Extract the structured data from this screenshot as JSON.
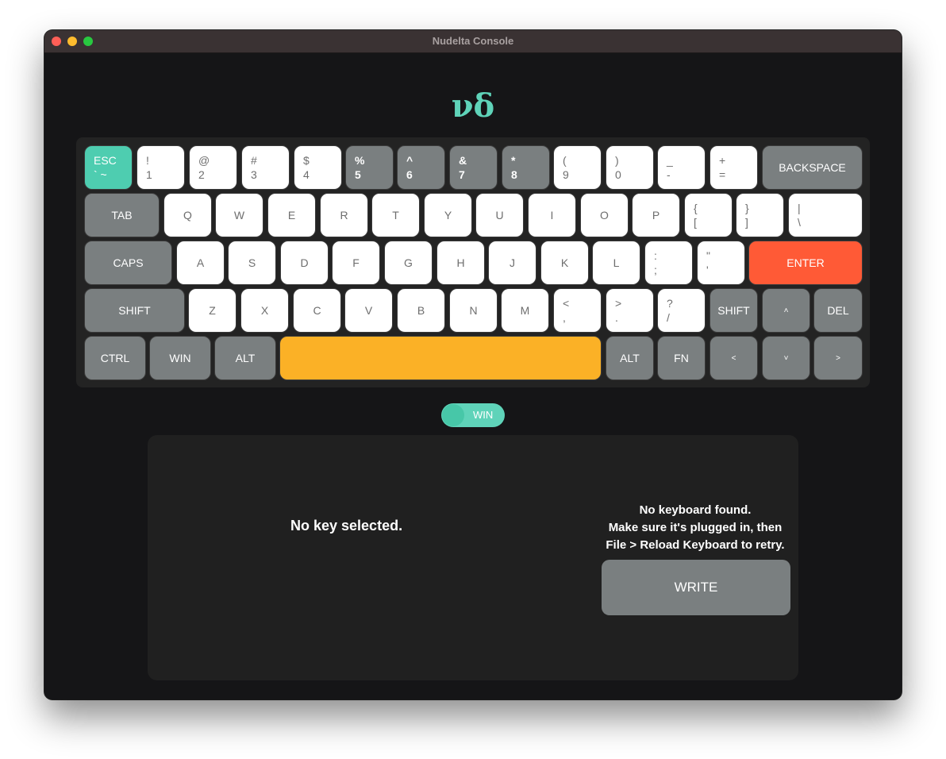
{
  "window": {
    "title": "Nudelta Console"
  },
  "logo": "νδ",
  "keyboard": {
    "row1": [
      {
        "top": "ESC",
        "bot": "` ~"
      },
      {
        "top": "!",
        "bot": "1"
      },
      {
        "top": "@",
        "bot": "2"
      },
      {
        "top": "#",
        "bot": "3"
      },
      {
        "top": "$",
        "bot": "4"
      },
      {
        "top": "%",
        "bot": "5"
      },
      {
        "top": "^",
        "bot": "6"
      },
      {
        "top": "&",
        "bot": "7"
      },
      {
        "top": "*",
        "bot": "8"
      },
      {
        "top": "(",
        "bot": "9"
      },
      {
        "top": ")",
        "bot": "0"
      },
      {
        "top": "_",
        "bot": "-"
      },
      {
        "top": "+",
        "bot": "="
      },
      {
        "label": "BACKSPACE"
      }
    ],
    "row2": [
      {
        "label": "TAB"
      },
      {
        "label": "Q"
      },
      {
        "label": "W"
      },
      {
        "label": "E"
      },
      {
        "label": "R"
      },
      {
        "label": "T"
      },
      {
        "label": "Y"
      },
      {
        "label": "U"
      },
      {
        "label": "I"
      },
      {
        "label": "O"
      },
      {
        "label": "P"
      },
      {
        "top": "{",
        "bot": "["
      },
      {
        "top": "}",
        "bot": "]"
      },
      {
        "top": "|",
        "bot": "\\"
      }
    ],
    "row3": [
      {
        "label": "CAPS"
      },
      {
        "label": "A"
      },
      {
        "label": "S"
      },
      {
        "label": "D"
      },
      {
        "label": "F"
      },
      {
        "label": "G"
      },
      {
        "label": "H"
      },
      {
        "label": "J"
      },
      {
        "label": "K"
      },
      {
        "label": "L"
      },
      {
        "top": ":",
        "bot": ";"
      },
      {
        "top": "\"",
        "bot": "'"
      },
      {
        "label": "ENTER"
      }
    ],
    "row4": [
      {
        "label": "SHIFT"
      },
      {
        "label": "Z"
      },
      {
        "label": "X"
      },
      {
        "label": "C"
      },
      {
        "label": "V"
      },
      {
        "label": "B"
      },
      {
        "label": "N"
      },
      {
        "label": "M"
      },
      {
        "top": "<",
        "bot": ","
      },
      {
        "top": ">",
        "bot": "."
      },
      {
        "top": "?",
        "bot": "/"
      },
      {
        "label": "SHIFT"
      },
      {
        "label": "˄"
      },
      {
        "label": "DEL"
      }
    ],
    "row5": [
      {
        "label": "CTRL"
      },
      {
        "label": "WIN"
      },
      {
        "label": "ALT"
      },
      {
        "label": ""
      },
      {
        "label": "ALT"
      },
      {
        "label": "FN"
      },
      {
        "label": "<"
      },
      {
        "label": "˅"
      },
      {
        "label": ">"
      }
    ]
  },
  "toggle": {
    "label": "WIN",
    "on": true
  },
  "panel": {
    "no_key": "No key selected.",
    "message_lines": [
      "No keyboard found.",
      "Make sure it's plugged in, then",
      "File > Reload Keyboard to retry."
    ],
    "write_label": "WRITE"
  },
  "colors": {
    "accent_teal": "#4ecdb0",
    "enter_orange": "#ff5a36",
    "space_yellow": "#fbb126",
    "gray_key": "#7a7f80"
  }
}
